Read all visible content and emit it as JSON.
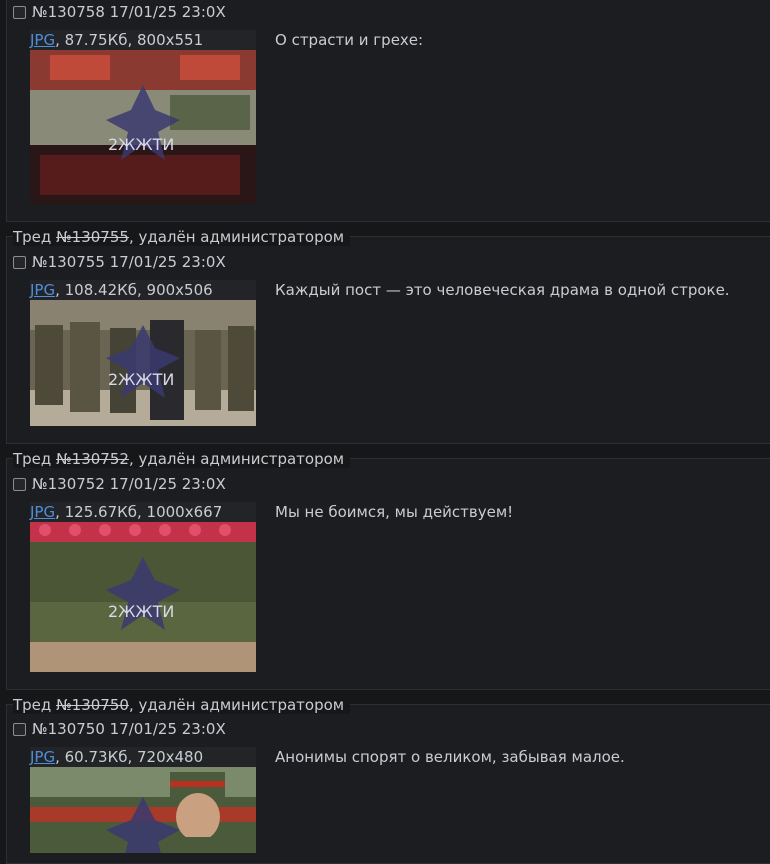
{
  "posts": [
    {
      "legend_prefix": "",
      "legend_number": "",
      "legend_suffix": "",
      "header": "№130758 17/01/25 23:0X",
      "file_type": "JPG",
      "file_meta": ", 87.75Кб, 800x551",
      "message": "О страсти и грехе:",
      "thumb_palette": [
        "#7a2e2a",
        "#a34a3a",
        "#5b6a4a",
        "#c44a4a",
        "#2a1a1a"
      ]
    },
    {
      "legend_prefix": "Тред ",
      "legend_number": "№130755",
      "legend_suffix": ", удалён администратором",
      "header": "№130755 17/01/25 23:0X",
      "file_type": "JPG",
      "file_meta": ", 108.42Кб, 900x506",
      "message": "Каждый пост — это человеческая драма в одной строке.",
      "thumb_palette": [
        "#6b6a5a",
        "#4e4a3c",
        "#7a6e58",
        "#3a3a32",
        "#b8b2a2"
      ]
    },
    {
      "legend_prefix": "Тред ",
      "legend_number": "№130752",
      "legend_suffix": ", удалён администратором",
      "header": "№130752 17/01/25 23:0X",
      "file_type": "JPG",
      "file_meta": ", 125.67Кб, 1000x667",
      "message": "Мы не боимся, мы действуем!",
      "thumb_palette": [
        "#c2334a",
        "#3e4a2c",
        "#5a6a3a",
        "#b89a82",
        "#2a2a22"
      ]
    },
    {
      "legend_prefix": "Тред ",
      "legend_number": "№130750",
      "legend_suffix": ", удалён администратором",
      "header": "№130750 17/01/25 23:0X",
      "file_type": "JPG",
      "file_meta": ", 60.73Кб, 720x480",
      "message": "Анонимы спорят о великом, забывая малое.",
      "thumb_palette": [
        "#8a9a7a",
        "#4a5a3a",
        "#c2a068",
        "#a83a2a",
        "#d4b49a"
      ]
    }
  ],
  "watermark_text": "2ЖЖТИ"
}
